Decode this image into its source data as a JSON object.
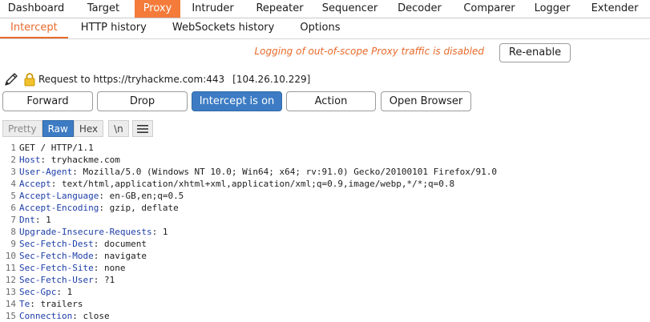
{
  "top_tabs": [
    {
      "label": "Dashboard",
      "active": false
    },
    {
      "label": "Target",
      "active": false
    },
    {
      "label": "Proxy",
      "active": true
    },
    {
      "label": "Intruder",
      "active": false
    },
    {
      "label": "Repeater",
      "active": false
    },
    {
      "label": "Sequencer",
      "active": false
    },
    {
      "label": "Decoder",
      "active": false
    },
    {
      "label": "Comparer",
      "active": false
    },
    {
      "label": "Logger",
      "active": false
    },
    {
      "label": "Extender",
      "active": false
    }
  ],
  "sub_tabs": [
    {
      "label": "Intercept",
      "active": true
    },
    {
      "label": "HTTP history",
      "active": false
    },
    {
      "label": "WebSockets history",
      "active": false
    },
    {
      "label": "Options",
      "active": false
    }
  ],
  "oos_message": "Logging of out-of-scope Proxy traffic is disabled",
  "reenable_label": "Re-enable",
  "request": {
    "label": "Request to https://tryhackme.com:443",
    "ip": "[104.26.10.229]"
  },
  "buttons": {
    "forward": "Forward",
    "drop": "Drop",
    "intercept": "Intercept is on",
    "action": "Action",
    "open_browser": "Open Browser"
  },
  "view_tabs": {
    "pretty": "Pretty",
    "raw": "Raw",
    "hex": "Hex",
    "newline": "\\n"
  },
  "icons": {
    "edit": "pencil-icon",
    "lock": "lock-icon",
    "menu": "hamburger-menu-icon"
  },
  "colors": {
    "accent": "#f47b3a",
    "primary_button": "#3d7cc4",
    "header_name": "#1d3ea8"
  },
  "lines": [
    {
      "n": "1",
      "name": "",
      "value": "GET / HTTP/1.1"
    },
    {
      "n": "2",
      "name": "Host",
      "value": "tryhackme.com"
    },
    {
      "n": "3",
      "name": "User-Agent",
      "value": "Mozilla/5.0 (Windows NT 10.0; Win64; x64; rv:91.0) Gecko/20100101 Firefox/91.0"
    },
    {
      "n": "4",
      "name": "Accept",
      "value": "text/html,application/xhtml+xml,application/xml;q=0.9,image/webp,*/*;q=0.8"
    },
    {
      "n": "5",
      "name": "Accept-Language",
      "value": "en-GB,en;q=0.5"
    },
    {
      "n": "6",
      "name": "Accept-Encoding",
      "value": "gzip, deflate"
    },
    {
      "n": "7",
      "name": "Dnt",
      "value": "1"
    },
    {
      "n": "8",
      "name": "Upgrade-Insecure-Requests",
      "value": "1"
    },
    {
      "n": "9",
      "name": "Sec-Fetch-Dest",
      "value": "document"
    },
    {
      "n": "10",
      "name": "Sec-Fetch-Mode",
      "value": "navigate"
    },
    {
      "n": "11",
      "name": "Sec-Fetch-Site",
      "value": "none"
    },
    {
      "n": "12",
      "name": "Sec-Fetch-User",
      "value": "?1"
    },
    {
      "n": "13",
      "name": "Sec-Gpc",
      "value": "1"
    },
    {
      "n": "14",
      "name": "Te",
      "value": "trailers"
    },
    {
      "n": "15",
      "name": "Connection",
      "value": "close"
    }
  ]
}
